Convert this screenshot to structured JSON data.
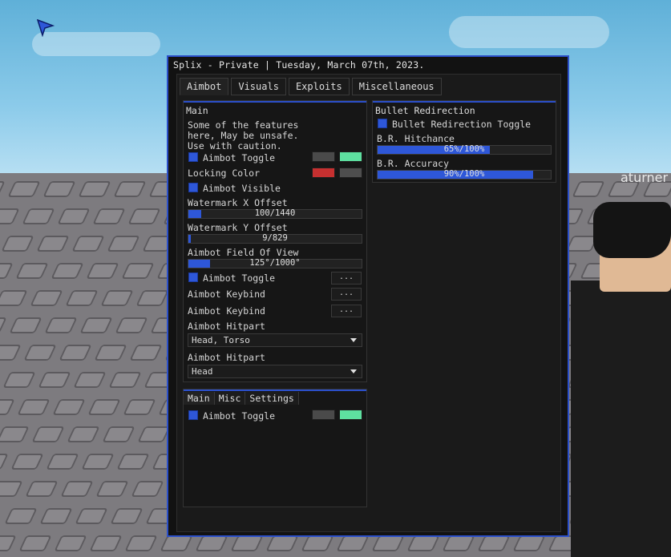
{
  "window": {
    "title": "Splix - Private | Tuesday, March 07th, 2023.",
    "accent": "#2b4fc9",
    "tabs": [
      {
        "label": "Aimbot",
        "active": true
      },
      {
        "label": "Visuals",
        "active": false
      },
      {
        "label": "Exploits",
        "active": false
      },
      {
        "label": "Miscellaneous",
        "active": false
      }
    ]
  },
  "main_section": {
    "title": "Main",
    "note_lines": [
      "Some of the features",
      "here, May be unsafe.",
      "Use with caution."
    ],
    "aimbot_toggle": {
      "label": "Aimbot Toggle",
      "checked": true,
      "color1": "#4a4a4a",
      "color2": "#5ee0a0"
    },
    "locking_color": {
      "label": "Locking Color",
      "color1": "#c63030",
      "color2": "#4e4e4e"
    },
    "aimbot_visible": {
      "label": "Aimbot Visible",
      "checked": true
    },
    "wm_x": {
      "label": "Watermark X Offset",
      "value_text": "100/1440",
      "fraction": 0.069
    },
    "wm_y": {
      "label": "Watermark Y Offset",
      "value_text": "9/829",
      "fraction": 0.011
    },
    "fov": {
      "label": "Aimbot Field Of View",
      "value_text": "125°/1000°",
      "fraction": 0.125
    },
    "aimbot_toggle2": {
      "label": "Aimbot Toggle",
      "checked": true,
      "button": "..."
    },
    "keybind1": {
      "label": "Aimbot Keybind",
      "button": "..."
    },
    "keybind2": {
      "label": "Aimbot Keybind",
      "button": "..."
    },
    "hitpart1": {
      "label": "Aimbot Hitpart",
      "value": "Head, Torso"
    },
    "hitpart2": {
      "label": "Aimbot Hitpart",
      "value": "Head"
    }
  },
  "bullet_section": {
    "title": "Bullet Redirection",
    "toggle": {
      "label": "Bullet Redirection Toggle",
      "checked": true
    },
    "hitchance": {
      "label": "B.R. Hitchance",
      "value_text": "65%/100%",
      "fraction": 0.65
    },
    "accuracy": {
      "label": "B.R. Accuracy",
      "value_text": "90%/100%",
      "fraction": 0.9
    }
  },
  "sub_section": {
    "tabs": [
      "Main",
      "Misc",
      "Settings"
    ],
    "toggle": {
      "label": "Aimbot Toggle",
      "checked": true,
      "color1": "#4a4a4a",
      "color2": "#5ee0a0"
    }
  },
  "scene": {
    "nametag": "aturner"
  }
}
